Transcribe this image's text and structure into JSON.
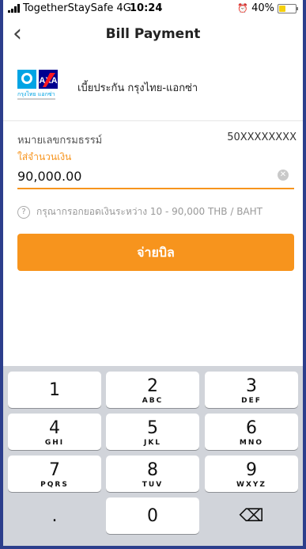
{
  "status_bar": {
    "carrier": "TogetherStaySafe",
    "network": "4G",
    "time": "10:24",
    "battery": "40%",
    "battery_level": 0.4
  },
  "nav": {
    "back_icon": "chevron-left-icon",
    "title": "Bill Payment"
  },
  "biller": {
    "logo_text": "กรุงไทย แอกซ่า",
    "name": "เบี้ยประกัน กรุงไทย-แอกซ่า"
  },
  "form": {
    "policy_label": "หมายเลขกรมธรรม์",
    "policy_value": "50XXXXXXXX",
    "amount_label": "ใส่จำนวนเงิน",
    "amount_value": "90,000.00",
    "hint": "กรุณากรอกยอดเงินระหว่าง 10 - 90,000 THB / BAHT",
    "pay_button": "จ่ายบิล"
  },
  "colors": {
    "accent": "#f7941d",
    "frame": "#2c3e8c"
  },
  "keypad": [
    {
      "num": "1",
      "letters": ""
    },
    {
      "num": "2",
      "letters": "ABC"
    },
    {
      "num": "3",
      "letters": "DEF"
    },
    {
      "num": "4",
      "letters": "GHI"
    },
    {
      "num": "5",
      "letters": "JKL"
    },
    {
      "num": "6",
      "letters": "MNO"
    },
    {
      "num": "7",
      "letters": "PQRS"
    },
    {
      "num": "8",
      "letters": "TUV"
    },
    {
      "num": "9",
      "letters": "WXYZ"
    },
    {
      "num": ".",
      "letters": ""
    },
    {
      "num": "0",
      "letters": ""
    },
    {
      "num": "⌫",
      "letters": ""
    }
  ]
}
